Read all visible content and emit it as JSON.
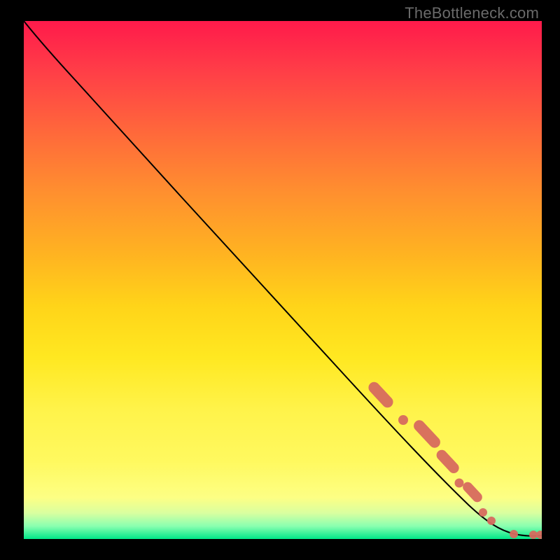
{
  "watermark": "TheBottleneck.com",
  "chart_data": {
    "type": "line",
    "title": "",
    "xlabel": "",
    "ylabel": "",
    "xlim": [
      0,
      100
    ],
    "ylim": [
      0,
      100
    ],
    "grid": false,
    "legend": false,
    "series": [
      {
        "name": "bottleneck-curve",
        "color": "#000000",
        "points": [
          {
            "x": 0,
            "y": 100
          },
          {
            "x": 5,
            "y": 97
          },
          {
            "x": 10,
            "y": 92
          },
          {
            "x": 20,
            "y": 81
          },
          {
            "x": 30,
            "y": 70
          },
          {
            "x": 40,
            "y": 59
          },
          {
            "x": 50,
            "y": 47.5
          },
          {
            "x": 60,
            "y": 36
          },
          {
            "x": 70,
            "y": 25
          },
          {
            "x": 80,
            "y": 14
          },
          {
            "x": 88,
            "y": 5
          },
          {
            "x": 92,
            "y": 2
          },
          {
            "x": 96,
            "y": 1
          },
          {
            "x": 100,
            "y": 1
          }
        ]
      },
      {
        "name": "markers",
        "type": "scatter",
        "color": "#d76a5e",
        "points": [
          {
            "x": 67,
            "y": 28
          },
          {
            "x": 68,
            "y": 27
          },
          {
            "x": 69,
            "y": 26
          },
          {
            "x": 70,
            "y": 25
          },
          {
            "x": 71,
            "y": 23.5
          },
          {
            "x": 72,
            "y": 22.5
          },
          {
            "x": 74,
            "y": 20.5
          },
          {
            "x": 76,
            "y": 18
          },
          {
            "x": 77,
            "y": 17
          },
          {
            "x": 78,
            "y": 16
          },
          {
            "x": 79,
            "y": 15
          },
          {
            "x": 80,
            "y": 14
          },
          {
            "x": 81,
            "y": 13
          },
          {
            "x": 82,
            "y": 12
          },
          {
            "x": 83,
            "y": 10.5
          },
          {
            "x": 84,
            "y": 9.5
          },
          {
            "x": 85,
            "y": 8
          },
          {
            "x": 86.5,
            "y": 6.5
          },
          {
            "x": 88,
            "y": 5
          },
          {
            "x": 89.5,
            "y": 3.5
          },
          {
            "x": 95,
            "y": 1
          },
          {
            "x": 99,
            "y": 1
          },
          {
            "x": 100,
            "y": 1
          }
        ]
      }
    ]
  }
}
